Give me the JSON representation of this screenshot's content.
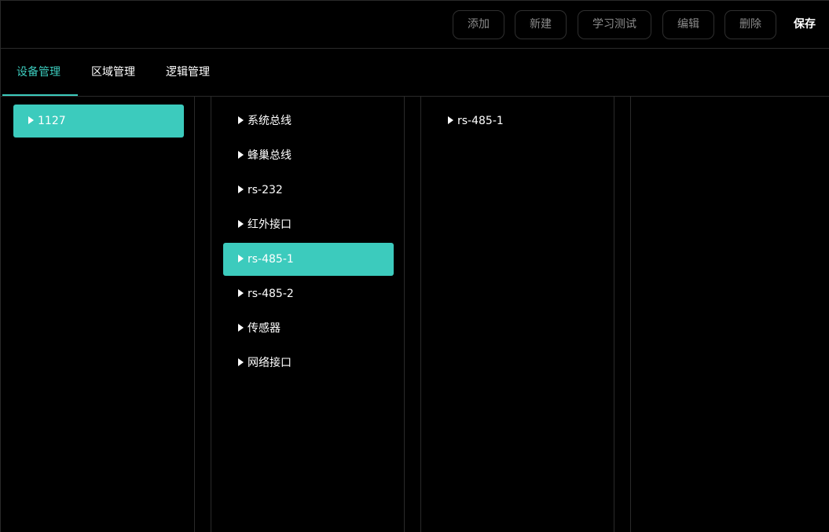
{
  "toolbar": {
    "add_label": "添加",
    "new_label": "新建",
    "learn_test_label": "学习测试",
    "edit_label": "编辑",
    "delete_label": "删除",
    "save_label": "保存"
  },
  "tabs": [
    {
      "label": "设备管理",
      "active": true
    },
    {
      "label": "区域管理",
      "active": false
    },
    {
      "label": "逻辑管理",
      "active": false
    }
  ],
  "columns": {
    "devices": [
      {
        "label": "1127",
        "selected": true
      }
    ],
    "interfaces": [
      {
        "label": "系统总线",
        "selected": false
      },
      {
        "label": "蜂巢总线",
        "selected": false
      },
      {
        "label": "rs-232",
        "selected": false
      },
      {
        "label": "红外接口",
        "selected": false
      },
      {
        "label": "rs-485-1",
        "selected": true
      },
      {
        "label": "rs-485-2",
        "selected": false
      },
      {
        "label": "传感器",
        "selected": false
      },
      {
        "label": "网络接口",
        "selected": false
      }
    ],
    "subitems": [
      {
        "label": "rs-485-1",
        "selected": false
      }
    ]
  },
  "colors": {
    "accent": "#3ccbbd",
    "background": "#000000",
    "border": "#2a2a2a"
  },
  "icons": {
    "tree_caret": "caret-right-icon"
  }
}
